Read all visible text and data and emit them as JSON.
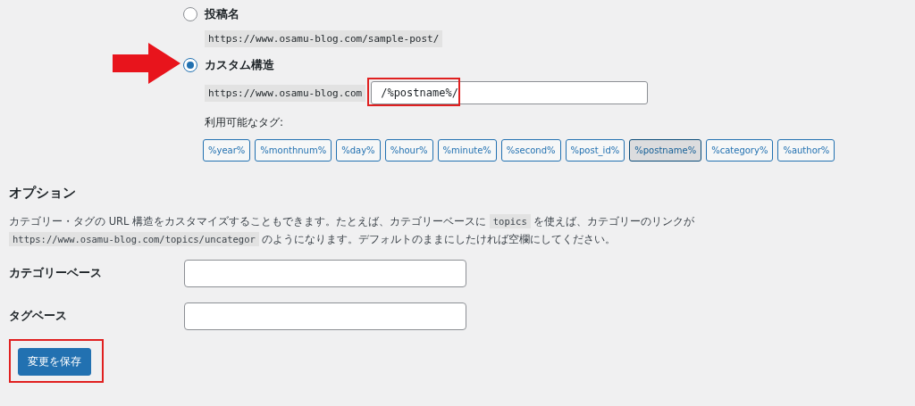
{
  "permalink_options": [
    {
      "label": "投稿名",
      "selected": false,
      "sample": "https://www.osamu-blog.com/sample-post/"
    },
    {
      "label": "カスタム構造",
      "selected": true,
      "base": "https://www.osamu-blog.com",
      "value": "/%postname%/"
    }
  ],
  "available_tags_label": "利用可能なタグ:",
  "tags": [
    {
      "label": "%year%",
      "selected": false
    },
    {
      "label": "%monthnum%",
      "selected": false
    },
    {
      "label": "%day%",
      "selected": false
    },
    {
      "label": "%hour%",
      "selected": false
    },
    {
      "label": "%minute%",
      "selected": false
    },
    {
      "label": "%second%",
      "selected": false
    },
    {
      "label": "%post_id%",
      "selected": false
    },
    {
      "label": "%postname%",
      "selected": true
    },
    {
      "label": "%category%",
      "selected": false
    },
    {
      "label": "%author%",
      "selected": false
    }
  ],
  "options": {
    "heading": "オプション",
    "description": [
      {
        "kind": "text",
        "text": "カテゴリー・タグの URL 構造をカスタマイズすることもできます。たとえば、カテゴリーベースに "
      },
      {
        "kind": "code",
        "text": "topics"
      },
      {
        "kind": "text",
        "text": " を使えば、カテゴリーのリンクが "
      },
      {
        "kind": "code",
        "text": "https://www.osamu-blog.com/topics/uncategor"
      },
      {
        "kind": "text",
        "text": " のようになります。デフォルトのままにしたければ空欄にしてください。"
      }
    ],
    "fields": [
      {
        "label": "カテゴリーベース"
      },
      {
        "label": "タグベース"
      }
    ]
  },
  "save_button": "変更を保存"
}
